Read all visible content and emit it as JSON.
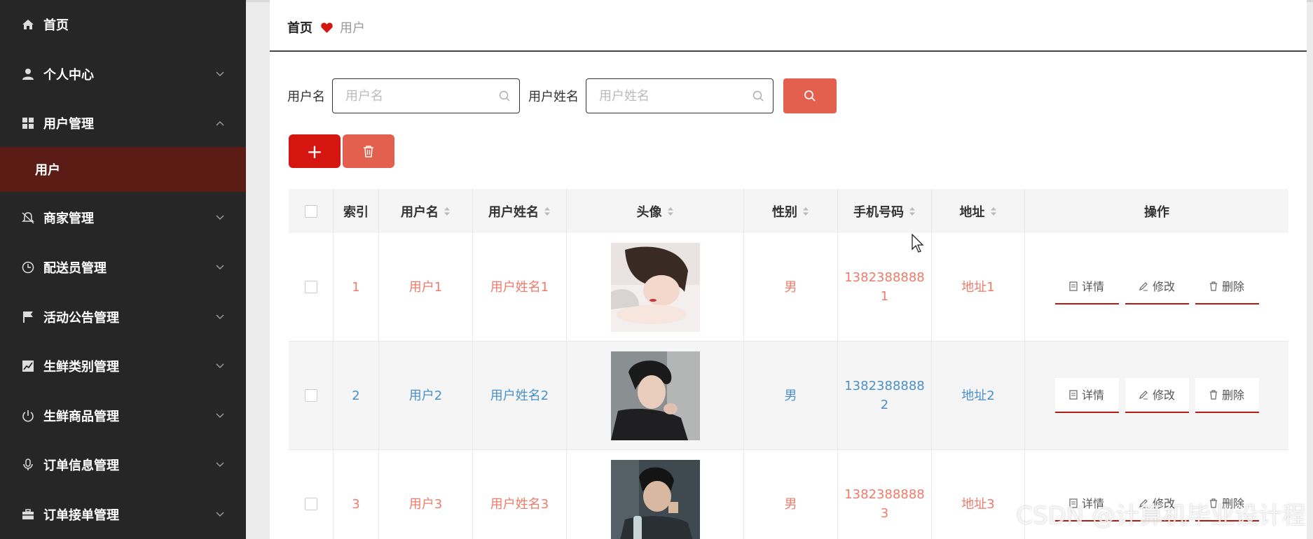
{
  "sidebar": {
    "items": [
      {
        "label": "首页",
        "icon": "home-icon",
        "chevron": ""
      },
      {
        "label": "个人中心",
        "icon": "user-icon",
        "chevron": "down"
      },
      {
        "label": "用户管理",
        "icon": "grid-icon",
        "chevron": "up"
      },
      {
        "label": "用户",
        "icon": "",
        "chevron": ""
      },
      {
        "label": "商家管理",
        "icon": "bell-off-icon",
        "chevron": "down"
      },
      {
        "label": "配送员管理",
        "icon": "clock-icon",
        "chevron": "down"
      },
      {
        "label": "活动公告管理",
        "icon": "flag-icon",
        "chevron": "down"
      },
      {
        "label": "生鲜类别管理",
        "icon": "chart-icon",
        "chevron": "down"
      },
      {
        "label": "生鲜商品管理",
        "icon": "power-icon",
        "chevron": "down"
      },
      {
        "label": "订单信息管理",
        "icon": "mic-icon",
        "chevron": "down"
      },
      {
        "label": "订单接单管理",
        "icon": "briefcase-icon",
        "chevron": "down"
      }
    ],
    "bg_color": "#262626",
    "active_color": "#5a1c14"
  },
  "breadcrumb": {
    "home": "首页",
    "current": "用户"
  },
  "search": {
    "username_label": "用户名",
    "username_placeholder": "用户名",
    "name_label": "用户姓名",
    "name_placeholder": "用户姓名"
  },
  "toolbar": {
    "add_label": "+"
  },
  "table": {
    "headers": {
      "index": "索引",
      "username": "用户名",
      "name": "用户姓名",
      "avatar": "头像",
      "gender": "性别",
      "phone": "手机号码",
      "address": "地址",
      "actions": "操作"
    },
    "rows": [
      {
        "index": "1",
        "username": "用户1",
        "name": "用户姓名1",
        "gender": "男",
        "phone_line1": "1382388888",
        "phone_line2": "1",
        "address": "地址1"
      },
      {
        "index": "2",
        "username": "用户2",
        "name": "用户姓名2",
        "gender": "男",
        "phone_line1": "1382388888",
        "phone_line2": "2",
        "address": "地址2"
      },
      {
        "index": "3",
        "username": "用户3",
        "name": "用户姓名3",
        "gender": "男",
        "phone_line1": "1382388888",
        "phone_line2": "3",
        "address": "地址3"
      }
    ],
    "actions": {
      "detail": "详情",
      "edit": "修改",
      "delete": "删除"
    }
  },
  "colors": {
    "accent_red": "#d5150f",
    "soft_red": "#e3604f",
    "link_red": "#ef7b6b",
    "link_blue": "#4a90c8"
  },
  "watermark": "CSDN @计算机毕业设计程"
}
